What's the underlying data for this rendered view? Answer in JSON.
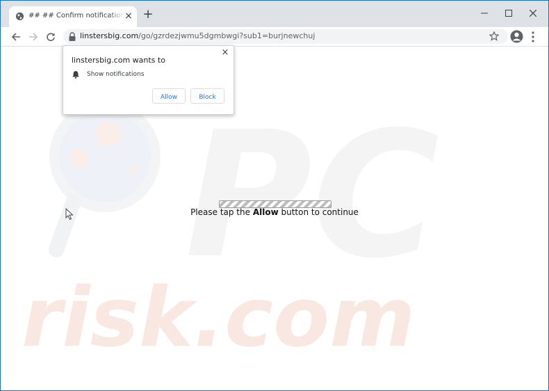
{
  "tab": {
    "title": "## ## Confirm notifications ## ## ## ##",
    "close": "×"
  },
  "new_tab": "+",
  "address_bar": {
    "host": "linstersbig.com",
    "path": "/go/gzrdezjwmu5dgmbwgi?sub1=burjnewchuj"
  },
  "notification_prompt": {
    "title": "linstersbig.com wants to",
    "permission": "Show notifications",
    "allow_label": "Allow",
    "block_label": "Block",
    "close": "×"
  },
  "page": {
    "message_before": "Please tap the ",
    "message_bold": "Allow",
    "message_after": " button to continue"
  },
  "watermark": {
    "big": "PC",
    "small": "risk.com"
  },
  "colors": {
    "window_border": "#1a6fc9",
    "titlebar": "#dee1e6",
    "accent": "#1a73e8",
    "watermark_text": "#f9e8e2"
  }
}
